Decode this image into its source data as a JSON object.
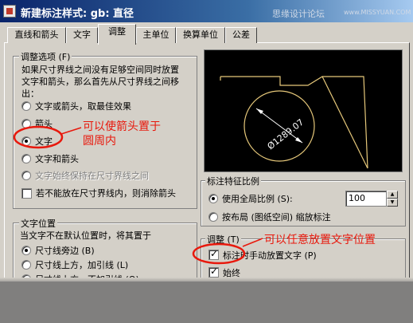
{
  "window": {
    "title": "新建标注样式: gb: 直径",
    "watermark": "思缘设计论坛",
    "watermark_url": "www.MISSYUAN.COM"
  },
  "tabs": [
    {
      "label": "直线和箭头"
    },
    {
      "label": "文字"
    },
    {
      "label": "调整",
      "active": true
    },
    {
      "label": "主单位"
    },
    {
      "label": "换算单位"
    },
    {
      "label": "公差"
    }
  ],
  "fit_options": {
    "legend": "调整选项 (F)",
    "description": "如果尺寸界线之间没有足够空间同时放置\n文字和箭头，那么首先从尺寸界线之间移\n出：",
    "options": [
      {
        "label": "文字或箭头，取最佳效果",
        "selected": false,
        "disabled": false
      },
      {
        "label": "箭头",
        "selected": false,
        "disabled": false
      },
      {
        "label": "文字",
        "selected": true,
        "disabled": false
      },
      {
        "label": "文字和箭头",
        "selected": false,
        "disabled": false
      },
      {
        "label": "文字始终保持在尺寸界线之间",
        "selected": false,
        "disabled": true
      }
    ],
    "suppress_label": "若不能放在尺寸界线内，则消除箭头"
  },
  "text_placement": {
    "legend": "文字位置",
    "description": "当文字不在默认位置时，将其置于",
    "options": [
      {
        "label": "尺寸线旁边 (B)",
        "selected": true
      },
      {
        "label": "尺寸线上方，加引线 (L)",
        "selected": false
      },
      {
        "label": "尺寸线上方，不加引线 (O)",
        "selected": false
      }
    ]
  },
  "scale": {
    "legend": "标注特征比例",
    "use_overall_label": "使用全局比例 (S):",
    "value": "100",
    "layout_label": "按布局 (图纸空间) 缩放标注"
  },
  "finetune": {
    "legend": "调整 (T)",
    "items": [
      {
        "label": "标注时手动放置文字 (P)",
        "checked": true
      },
      {
        "label": "始终",
        "checked": true
      }
    ]
  },
  "preview": {
    "dim_text": "Ø1289.07"
  },
  "annotations": {
    "a1_line1": "可以使箭头置于",
    "a1_line2": "圆周内",
    "a2": "可以任意放置文字位置"
  },
  "colors": {
    "annotation": "#e8180c",
    "title_bar": "#0a246a",
    "preview_line": "#e6c87a"
  }
}
